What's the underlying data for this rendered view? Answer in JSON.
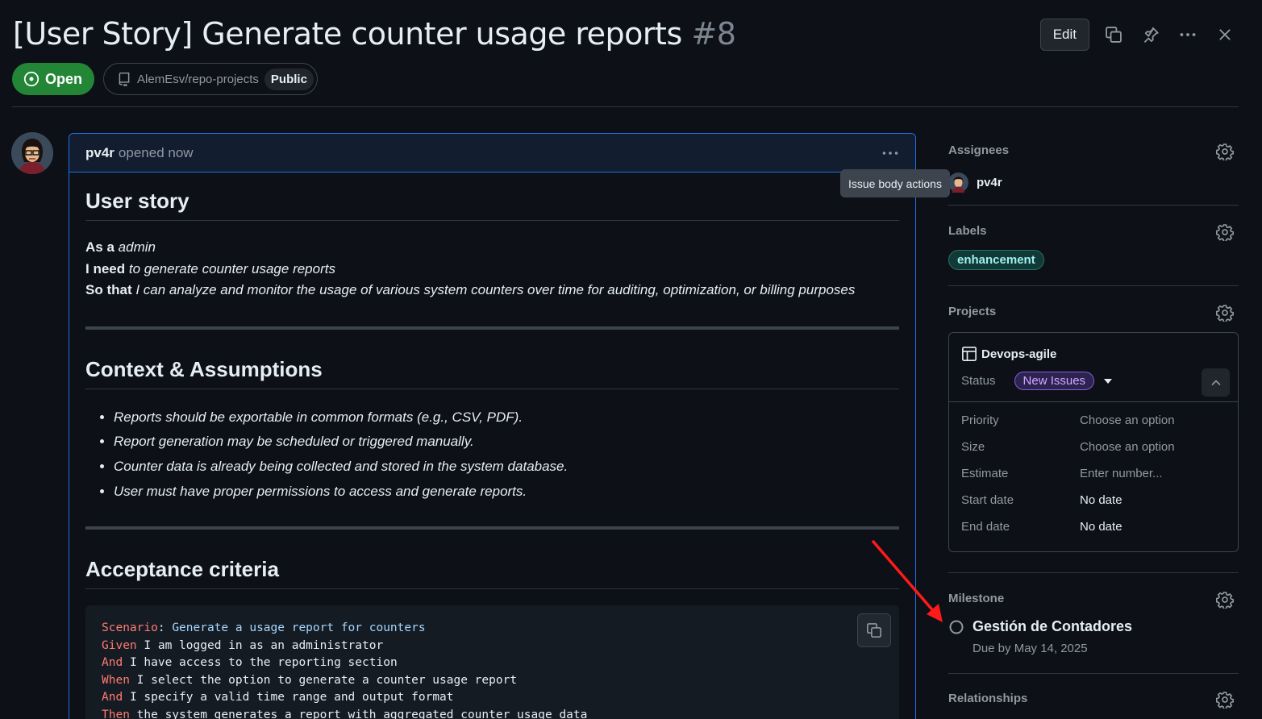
{
  "issue": {
    "title": "[User Story] Generate counter usage reports",
    "number": "#8",
    "state": "Open",
    "repo": "AlemEsv/repo-projects",
    "visibility": "Public"
  },
  "header_actions": {
    "edit_label": "Edit"
  },
  "comment": {
    "author": "pv4r",
    "meta": "opened now",
    "tooltip": "Issue body actions",
    "user_story": {
      "heading": "User story",
      "lines": [
        {
          "lead": "As a",
          "text": "admin"
        },
        {
          "lead": "I need",
          "text": "to generate counter usage reports"
        },
        {
          "lead": "So that",
          "text": "I can analyze and monitor the usage of various system counters over time for auditing, optimization, or billing purposes"
        }
      ]
    },
    "context": {
      "heading": "Context & Assumptions",
      "items": [
        "Reports should be exportable in common formats (e.g., CSV, PDF).",
        "Report generation may be scheduled or triggered manually.",
        "Counter data is already being collected and stored in the system database.",
        "User must have proper permissions to access and generate reports."
      ]
    },
    "acceptance": {
      "heading": "Acceptance criteria",
      "code": [
        {
          "kw": "Scenario",
          "sep": ": ",
          "text": "Generate a usage report for counters",
          "style": "str"
        },
        {
          "kw": "Given",
          "sep": " ",
          "text": "I am logged in as an administrator",
          "style": ""
        },
        {
          "kw": "And",
          "sep": " ",
          "text": "I have access to the reporting section",
          "style": ""
        },
        {
          "kw": "When",
          "sep": " ",
          "text": "I select the option to generate a counter usage report",
          "style": ""
        },
        {
          "kw": "And",
          "sep": " ",
          "text": "I specify a valid time range and output format",
          "style": ""
        },
        {
          "kw": "Then",
          "sep": " ",
          "text": "the system generates a report with aggregated counter usage data",
          "style": ""
        }
      ]
    }
  },
  "sidebar": {
    "assignees": {
      "title": "Assignees",
      "user": "pv4r"
    },
    "labels": {
      "title": "Labels",
      "items": [
        "enhancement"
      ]
    },
    "projects": {
      "title": "Projects",
      "project_name": "Devops-agile",
      "status_label": "Status",
      "status_value": "New Issues",
      "fields": [
        {
          "key": "Priority",
          "value": "Choose an option",
          "set": false
        },
        {
          "key": "Size",
          "value": "Choose an option",
          "set": false
        },
        {
          "key": "Estimate",
          "value": "Enter number...",
          "set": false
        },
        {
          "key": "Start date",
          "value": "No date",
          "set": true
        },
        {
          "key": "End date",
          "value": "No date",
          "set": true
        }
      ]
    },
    "milestone": {
      "title": "Milestone",
      "name": "Gestión de Contadores",
      "due": "Due by May 14, 2025"
    },
    "relationships": {
      "title": "Relationships"
    }
  },
  "colors": {
    "open_green": "#238636",
    "focus_blue": "#1f6feb",
    "label_text": "#a2eeef",
    "status_purple": "#d2a8ff",
    "annotation_arrow": "#ff1a1a"
  }
}
